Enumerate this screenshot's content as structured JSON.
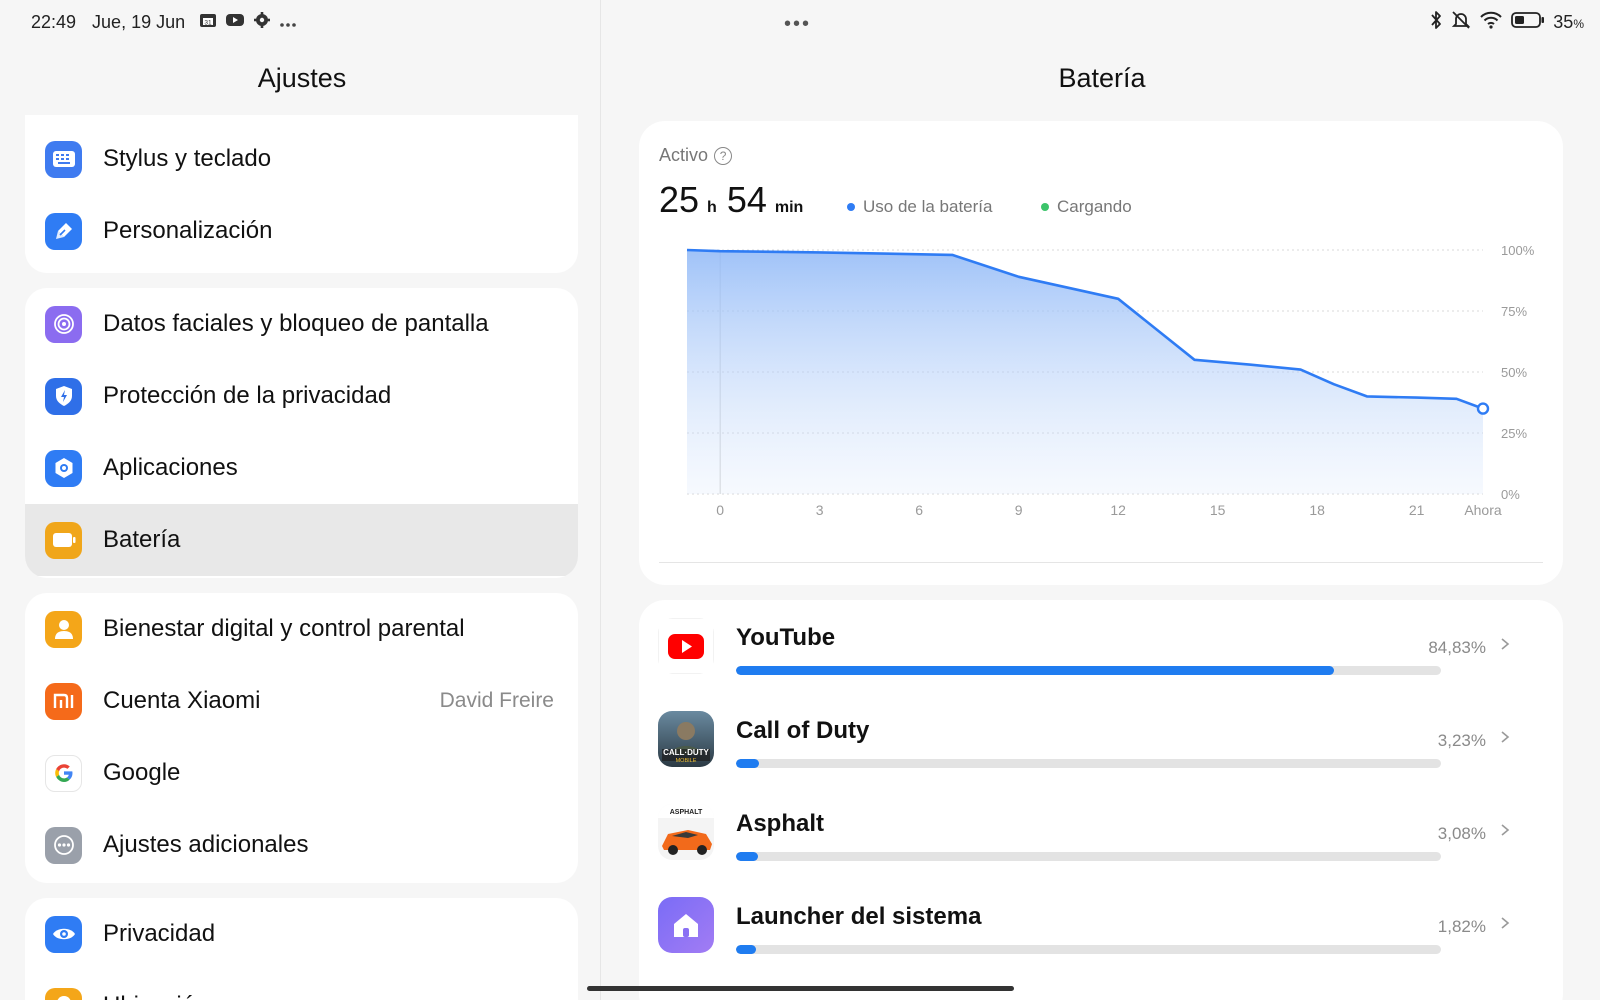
{
  "status_bar": {
    "time": "22:49",
    "date": "Jue, 19 Jun",
    "left_icons": [
      "calendar-icon",
      "youtube-icon",
      "settings-gear-icon",
      "more-notifications-icon"
    ],
    "more_dots": "•••",
    "battery_percent": "35",
    "battery_unit": "%",
    "right_icons": [
      "bluetooth-icon",
      "silent-bell-icon",
      "wifi-icon",
      "battery-icon"
    ]
  },
  "left": {
    "title": "Ajustes",
    "groups": [
      [
        {
          "label": "Stylus y teclado",
          "icon": "keyboard-icon",
          "color": "#3f7bf0"
        },
        {
          "label": "Personalización",
          "icon": "brush-icon",
          "color": "#2f7cf4"
        }
      ],
      [
        {
          "label": "Datos faciales y bloqueo de pantalla",
          "icon": "face-lock-icon",
          "color": "#8b6cf0"
        },
        {
          "label": "Protección de la privacidad",
          "icon": "privacy-shield-icon",
          "color": "#2f6fe8"
        },
        {
          "label": "Aplicaciones",
          "icon": "apps-gear-icon",
          "color": "#2f7cf4"
        },
        {
          "label": "Batería",
          "icon": "battery-icon",
          "color": "#f0a61a",
          "active": true
        }
      ],
      [
        {
          "label": "Bienestar digital y control parental",
          "icon": "wellbeing-icon",
          "color": "#f4a619"
        },
        {
          "label": "Cuenta Xiaomi",
          "icon": "xiaomi-icon",
          "color": "#f56a1a",
          "value": "David Freire"
        },
        {
          "label": "Google",
          "icon": "google-icon",
          "color": "#ffffff"
        },
        {
          "label": "Ajustes adicionales",
          "icon": "more-settings-icon",
          "color": "#9aa0aa"
        }
      ],
      [
        {
          "label": "Privacidad",
          "icon": "eye-icon",
          "color": "#2f7cf4"
        },
        {
          "label": "Ubicación",
          "icon": "location-icon",
          "color": "#f4a619"
        }
      ]
    ]
  },
  "right": {
    "title": "Batería",
    "activo_label": "Activo",
    "help_symbol": "?",
    "duration": {
      "hours": "25",
      "hours_unit": "h",
      "minutes": "54",
      "minutes_unit": "min"
    },
    "legend": [
      {
        "label": "Uso de la batería",
        "color": "#2f7cf4"
      },
      {
        "label": "Cargando",
        "color": "#3cc46a"
      }
    ],
    "apps": [
      {
        "name": "YouTube",
        "percent": "84,83%",
        "fraction": 0.8483,
        "icon": "youtube-app-icon"
      },
      {
        "name": "Call of Duty",
        "percent": "3,23%",
        "fraction": 0.0323,
        "icon": "call-of-duty-app-icon"
      },
      {
        "name": "Asphalt",
        "percent": "3,08%",
        "fraction": 0.0308,
        "icon": "asphalt-app-icon"
      },
      {
        "name": "Launcher del sistema",
        "percent": "1,82%",
        "fraction": 0.0182,
        "icon": "launcher-app-icon"
      }
    ]
  },
  "chart_data": {
    "type": "area",
    "title": "",
    "xlabel": "",
    "ylabel": "",
    "x_ticks": [
      "0",
      "3",
      "6",
      "9",
      "12",
      "15",
      "18",
      "21",
      "Ahora"
    ],
    "y_ticks": [
      "100%",
      "75%",
      "50%",
      "25%",
      "0%"
    ],
    "xlim": [
      0,
      23
    ],
    "ylim": [
      0,
      100
    ],
    "series": [
      {
        "name": "Uso de la batería",
        "x": [
          -1,
          0,
          3,
          7,
          9,
          12,
          14.3,
          16,
          17.5,
          18.5,
          19.5,
          21,
          22.2,
          23
        ],
        "values": [
          100,
          99.5,
          99,
          98,
          89,
          80,
          55,
          53,
          51,
          45,
          40,
          39.5,
          39,
          35
        ]
      }
    ],
    "grid": true,
    "legend_position": "top"
  }
}
